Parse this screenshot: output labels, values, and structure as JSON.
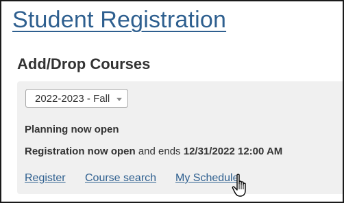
{
  "header": {
    "title": "Student Registration"
  },
  "section": {
    "title": "Add/Drop Courses"
  },
  "term_select": {
    "value": "2022-2023 - Fall"
  },
  "status": {
    "planning": "Planning now open",
    "registration_label": "Registration now open",
    "registration_middle": " and ends ",
    "registration_end": "12/31/2022 12:00 AM"
  },
  "links": {
    "register": "Register",
    "course_search": "Course search",
    "my_schedule": "My Schedule"
  },
  "colors": {
    "link": "#2e5f8f",
    "panel": "#f0f0f0"
  }
}
